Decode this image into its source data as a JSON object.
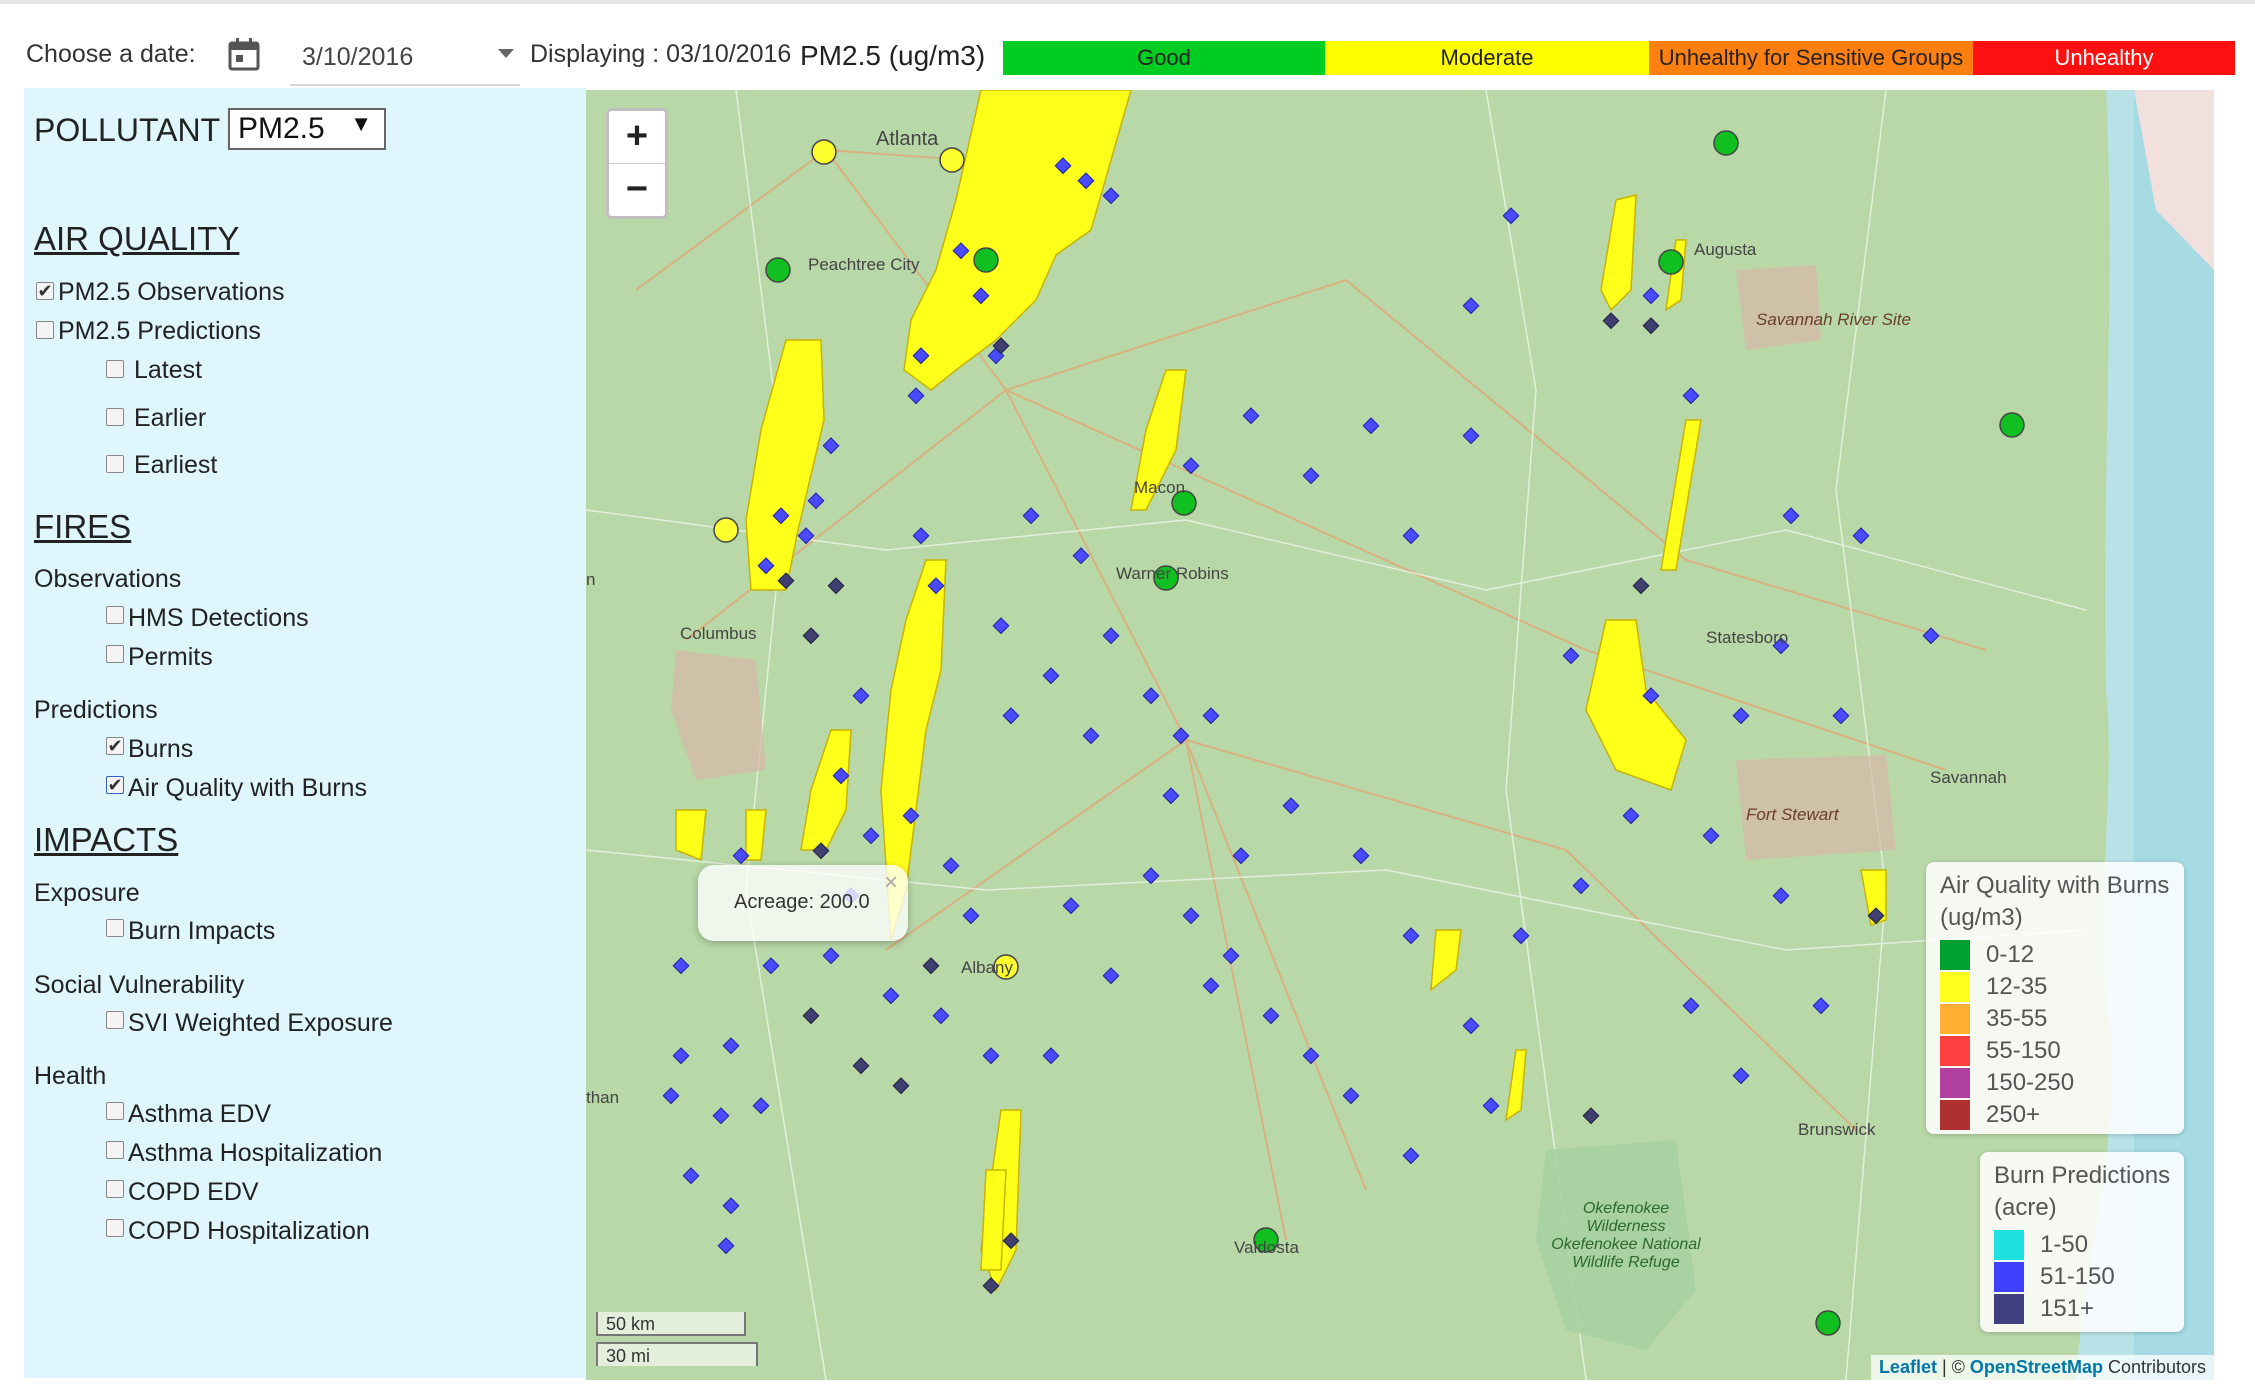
{
  "toolbar": {
    "date_label": "Choose a date:",
    "date_value": "3/10/2016",
    "displaying_label": "Displaying : 03/10/2016",
    "unit_label": "PM2.5 (ug/m3)",
    "aq_scale": [
      {
        "label": "Good",
        "color": "#00cc22"
      },
      {
        "label": "Moderate",
        "color": "#ffff00"
      },
      {
        "label": "Unhealthy for Sensitive Groups",
        "color": "#ff8010"
      },
      {
        "label": "Unhealthy",
        "color": "#ff1010",
        "text_color": "#ffffff"
      }
    ]
  },
  "sidebar": {
    "pollutant_label": "POLLUTANT",
    "pollutant_value": "PM2.5",
    "air_quality": {
      "heading": "AIR QUALITY",
      "pm25_obs": "PM2.5 Observations",
      "pm25_pred": "PM2.5 Predictions",
      "latest": "Latest",
      "earlier": "Earlier",
      "earliest": "Earliest"
    },
    "fires": {
      "heading": "FIRES",
      "observations": "Observations",
      "hms": "HMS Detections",
      "permits": "Permits",
      "predictions": "Predictions",
      "burns": "Burns",
      "aq_with_burns": "Air Quality with Burns"
    },
    "impacts": {
      "heading": "IMPACTS",
      "exposure": "Exposure",
      "burn_impacts": "Burn Impacts",
      "social": "Social Vulnerability",
      "svi": "SVI Weighted Exposure",
      "health": "Health",
      "asthma_edv": "Asthma EDV",
      "asthma_hosp": "Asthma Hospitalization",
      "copd_edv": "COPD EDV",
      "copd_hosp": "COPD Hospitalization"
    }
  },
  "map": {
    "zoom_in": "+",
    "zoom_out": "−",
    "popup_text": "Acreage: 200.0",
    "popup_close": "×",
    "places": {
      "atlanta": "Atlanta",
      "peachtree": "Peachtree City",
      "augusta": "Augusta",
      "savannah_river": "Savannah River Site",
      "macon": "Macon",
      "warner_robins": "Warner Robins",
      "columbus": "Columbus",
      "statesboro": "Statesboro",
      "savannah": "Savannah",
      "fort_stewart": "Fort Stewart",
      "albany": "Albany",
      "brunswick": "Brunswick",
      "valdosta": "Valdosta",
      "okefenokee": "Okefenokee Wilderness Okefenokee National Wildlife Refuge",
      "than": "than",
      "n": "n"
    },
    "scale_km": "50 km",
    "scale_mi": "30 mi",
    "attribution_leaflet": "Leaflet",
    "attribution_sep": " | © ",
    "attribution_osm": "OpenStreetMap",
    "attribution_tail": " Contributors"
  },
  "legend_aq": {
    "title": "Air Quality with Burns",
    "subtitle": "(ug/m3)",
    "items": [
      {
        "label": "0-12",
        "color": "#00a030"
      },
      {
        "label": "12-35",
        "color": "#ffff20"
      },
      {
        "label": "35-55",
        "color": "#ffb030"
      },
      {
        "label": "55-150",
        "color": "#ff4040"
      },
      {
        "label": "150-250",
        "color": "#b040a0"
      },
      {
        "label": "250+",
        "color": "#b03030"
      }
    ]
  },
  "legend_burn": {
    "title": "Burn Predictions",
    "subtitle": "(acre)",
    "items": [
      {
        "label": "1-50",
        "color": "#20e0e0"
      },
      {
        "label": "51-150",
        "color": "#4040ff"
      },
      {
        "label": "151+",
        "color": "#404080"
      }
    ]
  }
}
